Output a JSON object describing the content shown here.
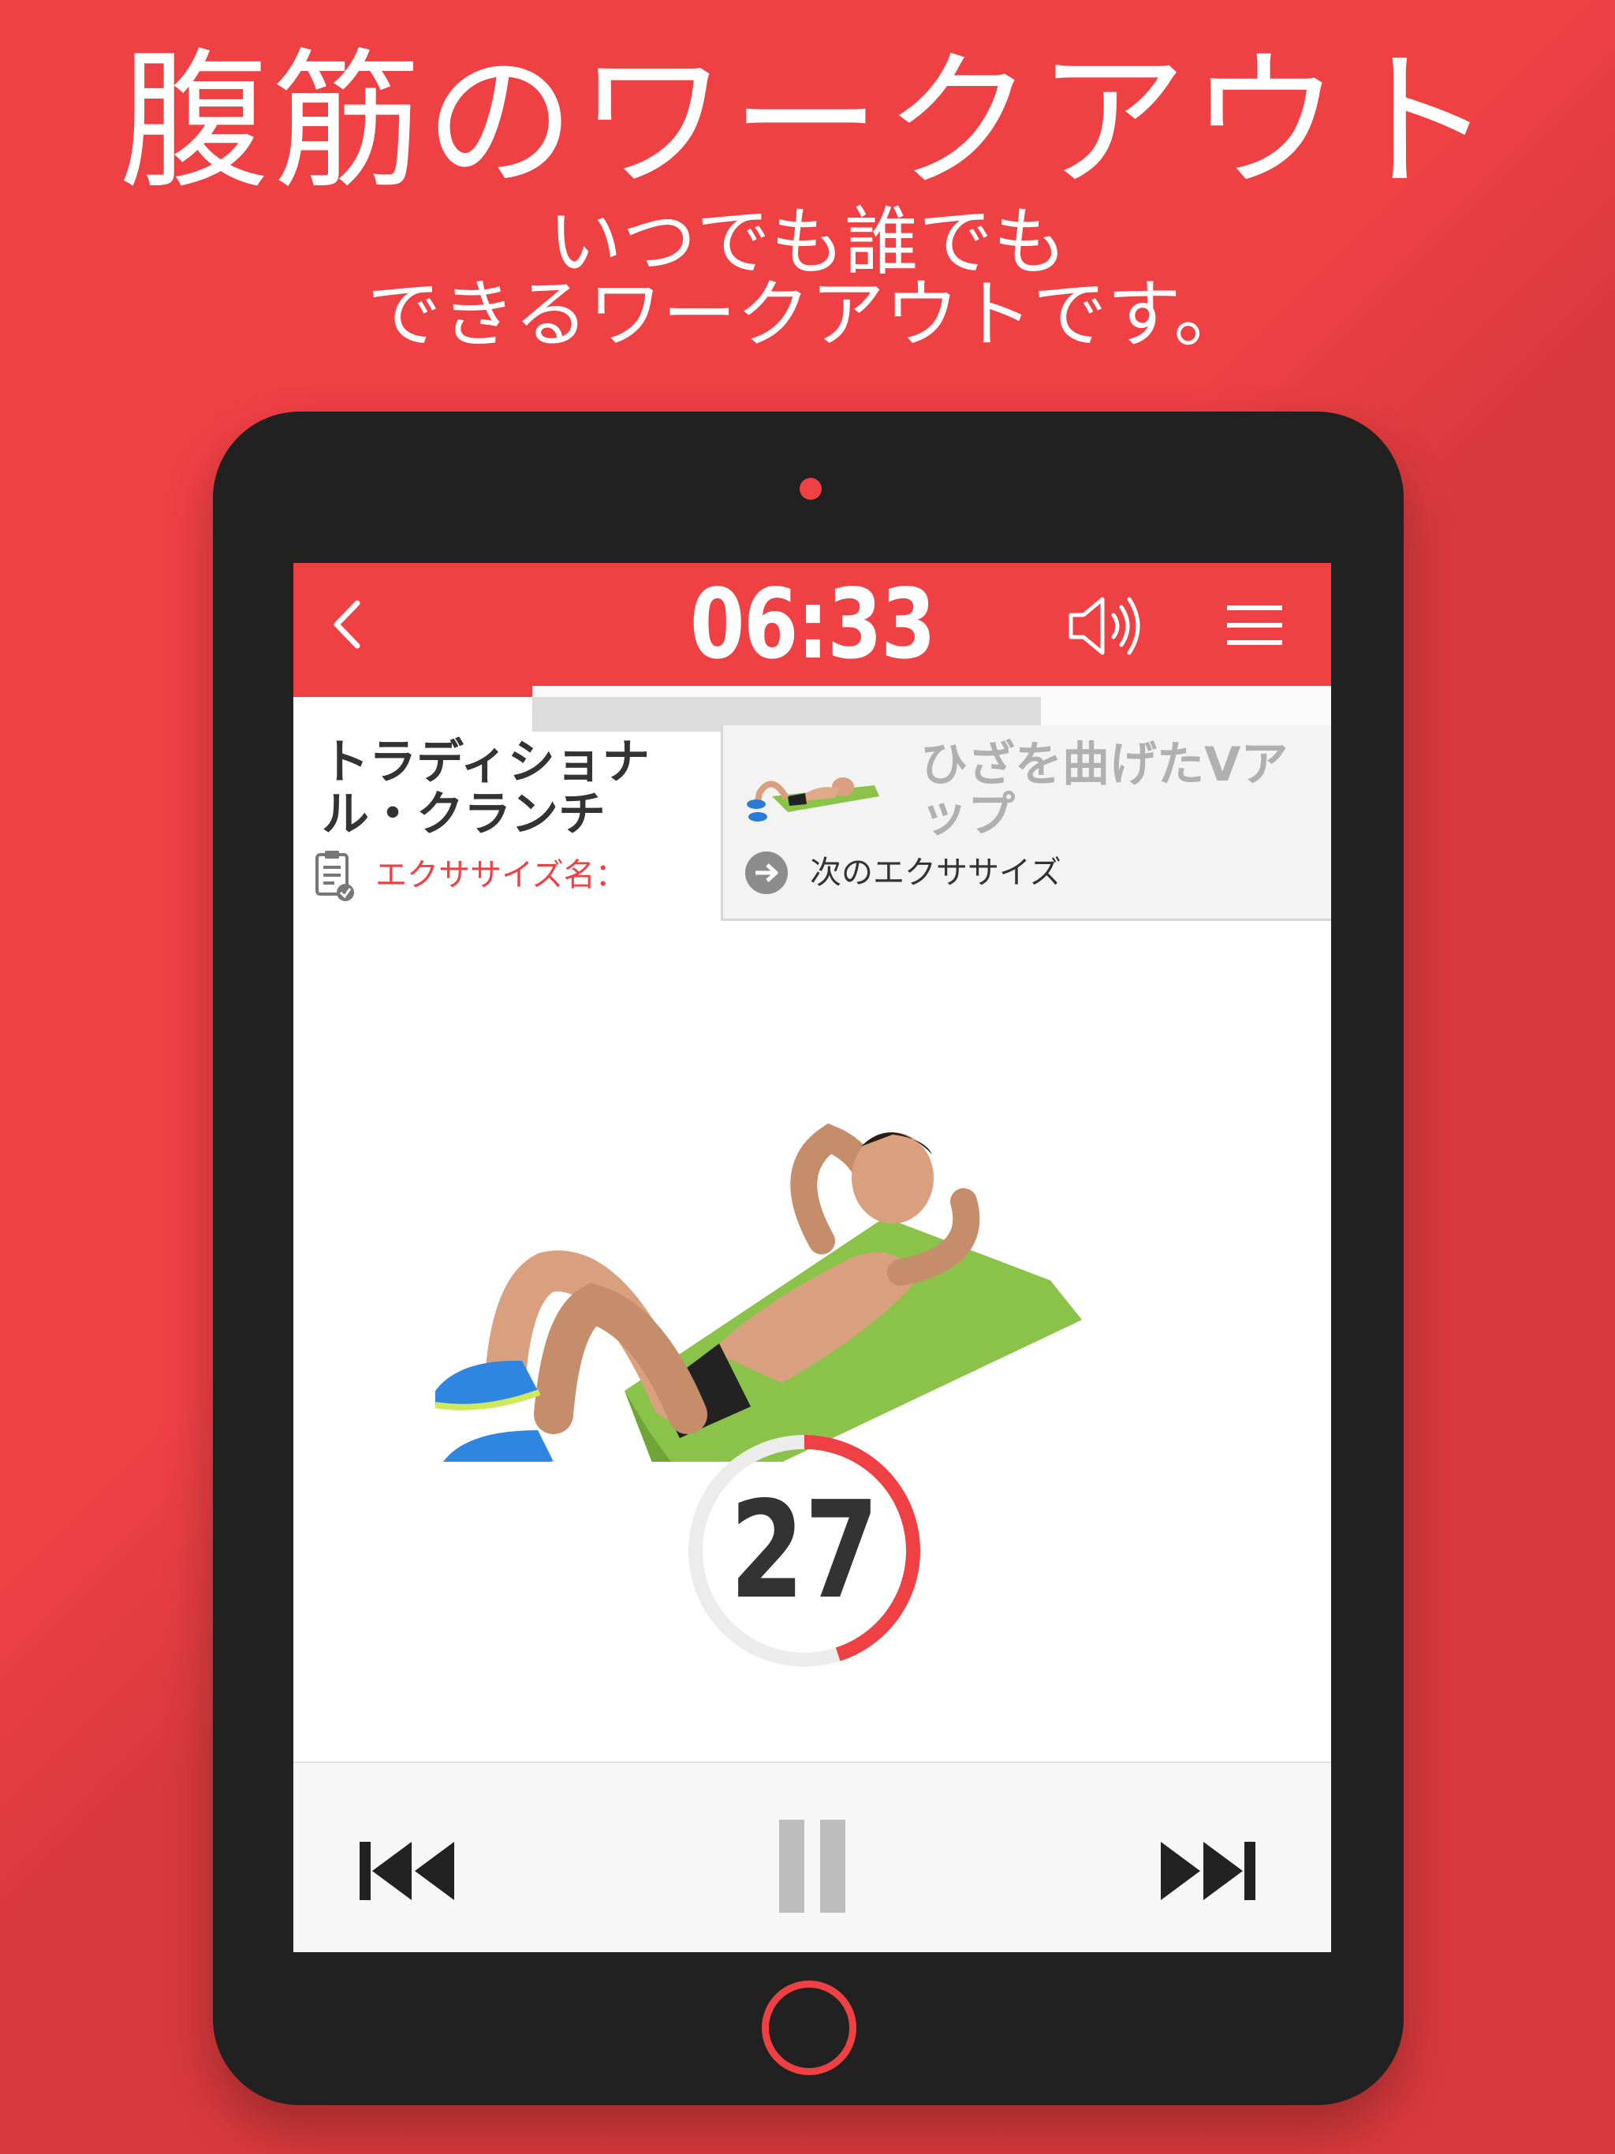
{
  "promo": {
    "title": "腹筋のワークアウト",
    "subtitle_line1": "いつでも誰でも",
    "subtitle_line2": "できるワークアウトです。"
  },
  "header": {
    "timer": "06:33",
    "back_icon": "chevron-left-icon",
    "sound_icon": "speaker-icon",
    "menu_icon": "hamburger-menu-icon"
  },
  "progress": {
    "completed_fraction": 0.23,
    "next_fraction": 0.72
  },
  "current_exercise": {
    "name": "トラディショナル・クランチ",
    "label": "エクササイズ名："
  },
  "next_exercise": {
    "name": "ひざを曲げたVアップ",
    "label": "次のエクササイズ"
  },
  "countdown": {
    "value": "27",
    "fraction": 0.45
  },
  "controls": {
    "previous_icon": "skip-previous-icon",
    "pause_icon": "pause-icon",
    "next_icon": "skip-next-icon"
  },
  "colors": {
    "accent": "#ef4044",
    "tablet": "#212121",
    "paused": "#bdbdbd"
  }
}
